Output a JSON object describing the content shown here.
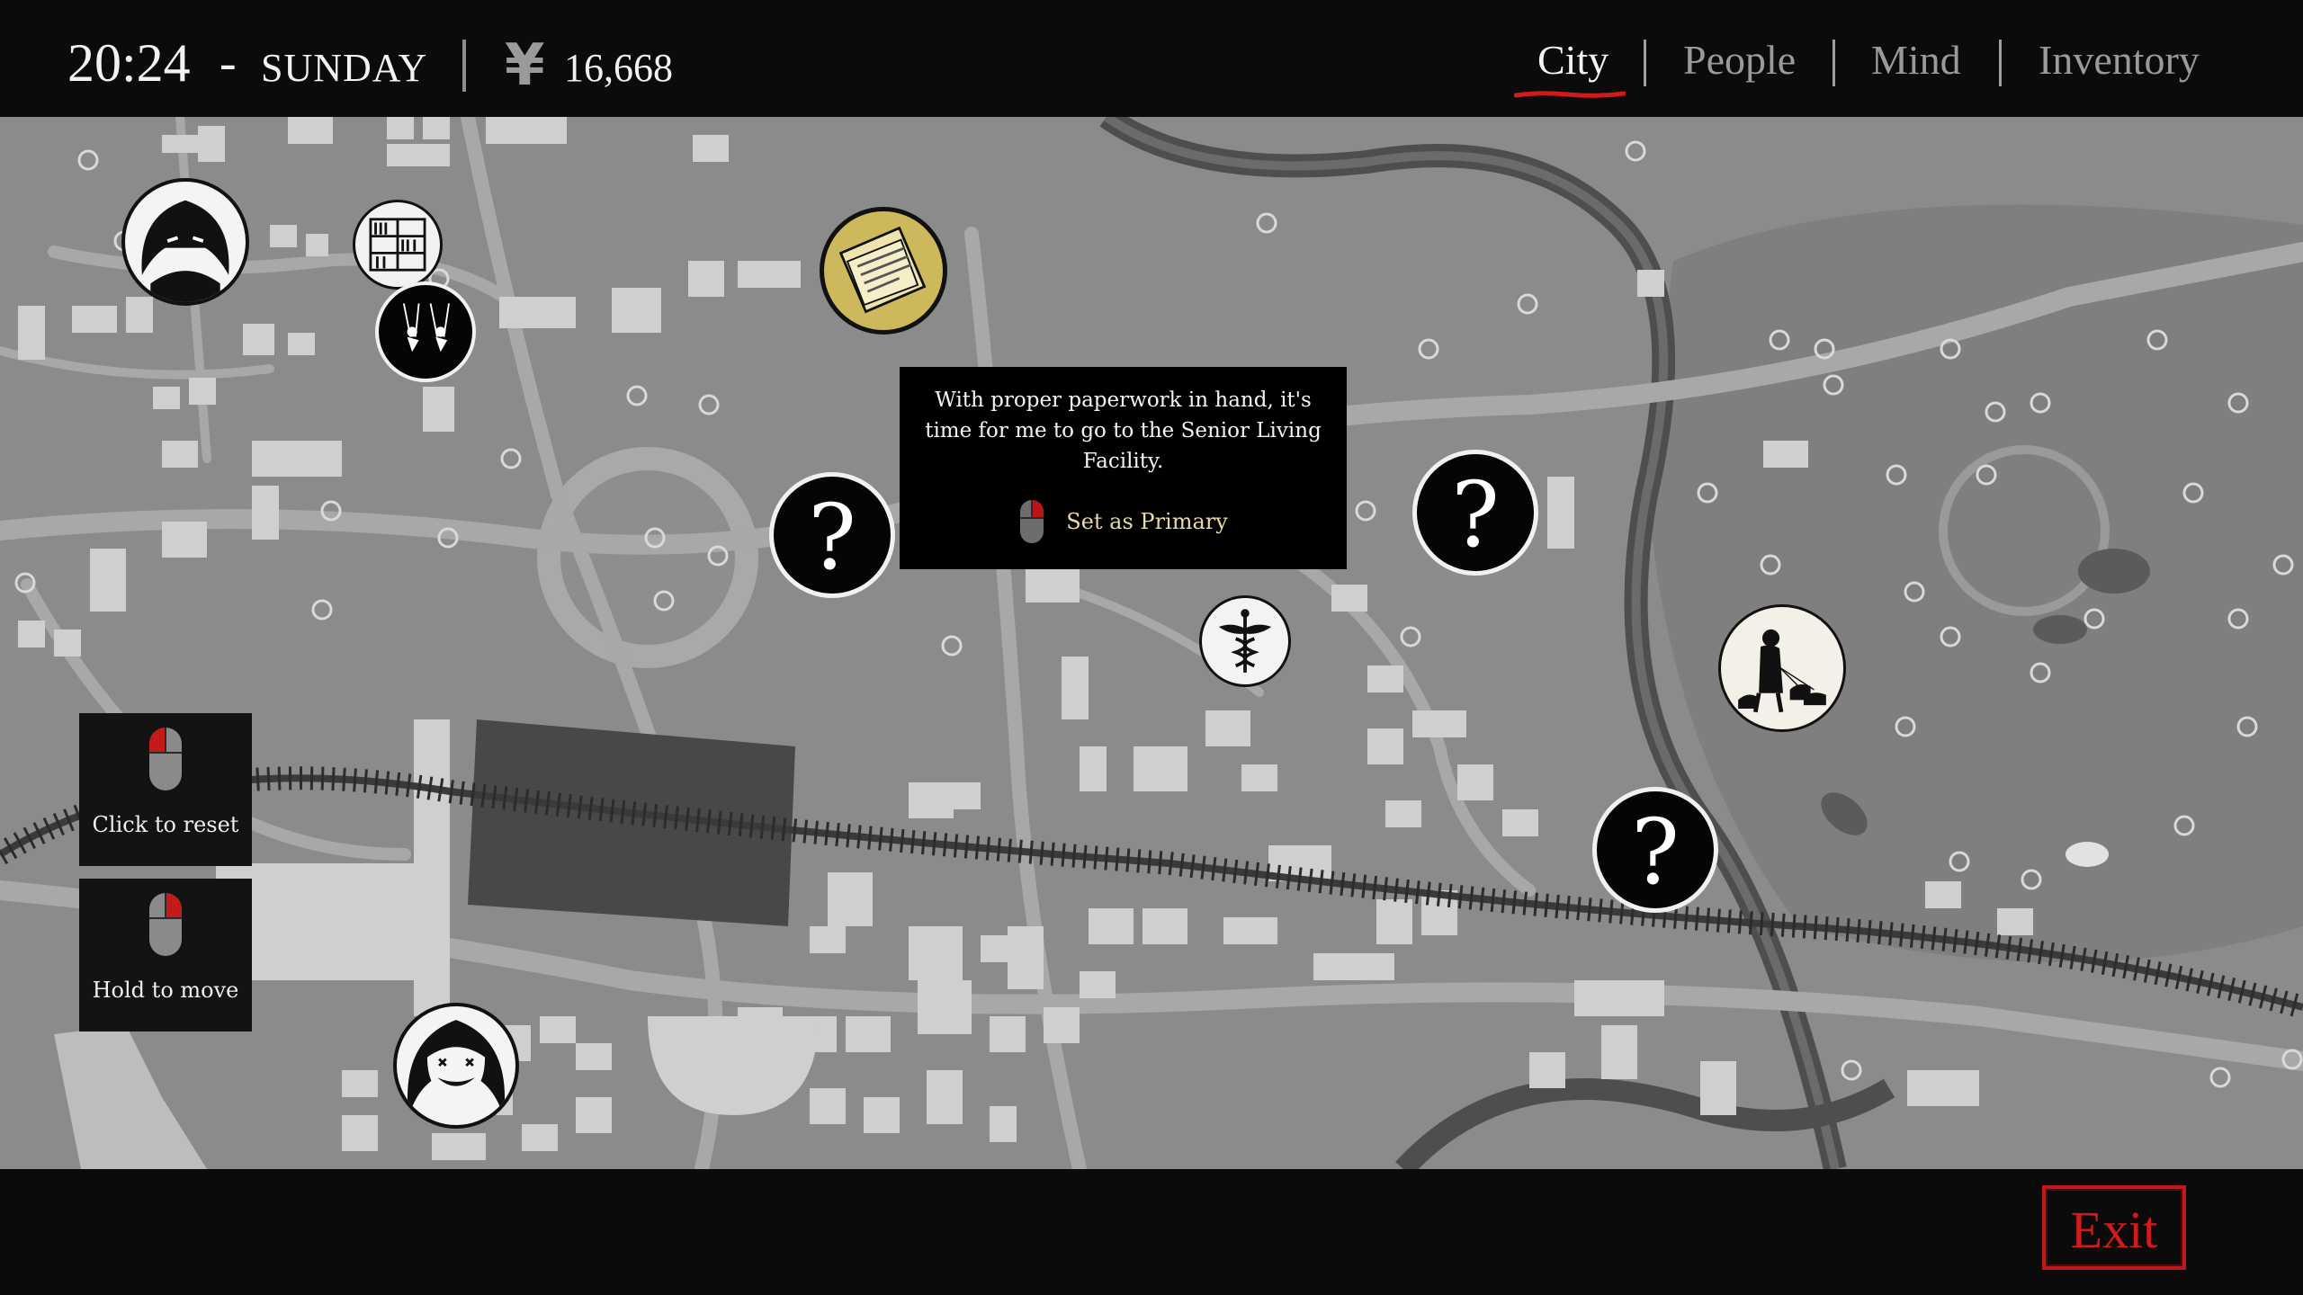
{
  "header": {
    "time": "20:24",
    "separator": "-",
    "day": "SUNDAY",
    "currency_symbol": "¥",
    "money": "16,668"
  },
  "tabs": [
    {
      "label": "City",
      "active": true
    },
    {
      "label": "People",
      "active": false
    },
    {
      "label": "Mind",
      "active": false
    },
    {
      "label": "Inventory",
      "active": false
    }
  ],
  "map": {
    "markers": [
      {
        "name": "character-hooded-figure-marker",
        "type": "portrait"
      },
      {
        "name": "library-shelves-marker",
        "type": "location"
      },
      {
        "name": "playground-swings-marker",
        "type": "location"
      },
      {
        "name": "paperwork-documents-marker",
        "type": "objective",
        "selected": true
      },
      {
        "name": "unknown-location-marker",
        "type": "unknown",
        "glyph": "?"
      },
      {
        "name": "hospital-caduceus-marker",
        "type": "location"
      },
      {
        "name": "unknown-location-marker",
        "type": "unknown",
        "glyph": "?"
      },
      {
        "name": "park-dog-walker-marker",
        "type": "location"
      },
      {
        "name": "unknown-location-marker",
        "type": "unknown",
        "glyph": "?"
      },
      {
        "name": "character-smiling-woman-marker",
        "type": "portrait"
      }
    ],
    "tooltip": {
      "text": "With proper paperwork in hand, it's time for me to go to the Senior Living Facility.",
      "action_label": "Set as Primary"
    }
  },
  "controls": {
    "reset_label": "Click to reset",
    "move_label": "Hold to move"
  },
  "footer": {
    "exit_label": "Exit"
  },
  "colors": {
    "background": "#0b0b0b",
    "map_base": "#8a8a8a",
    "accent_red": "#d11a1a",
    "tooltip_action": "#e8d9a8"
  }
}
